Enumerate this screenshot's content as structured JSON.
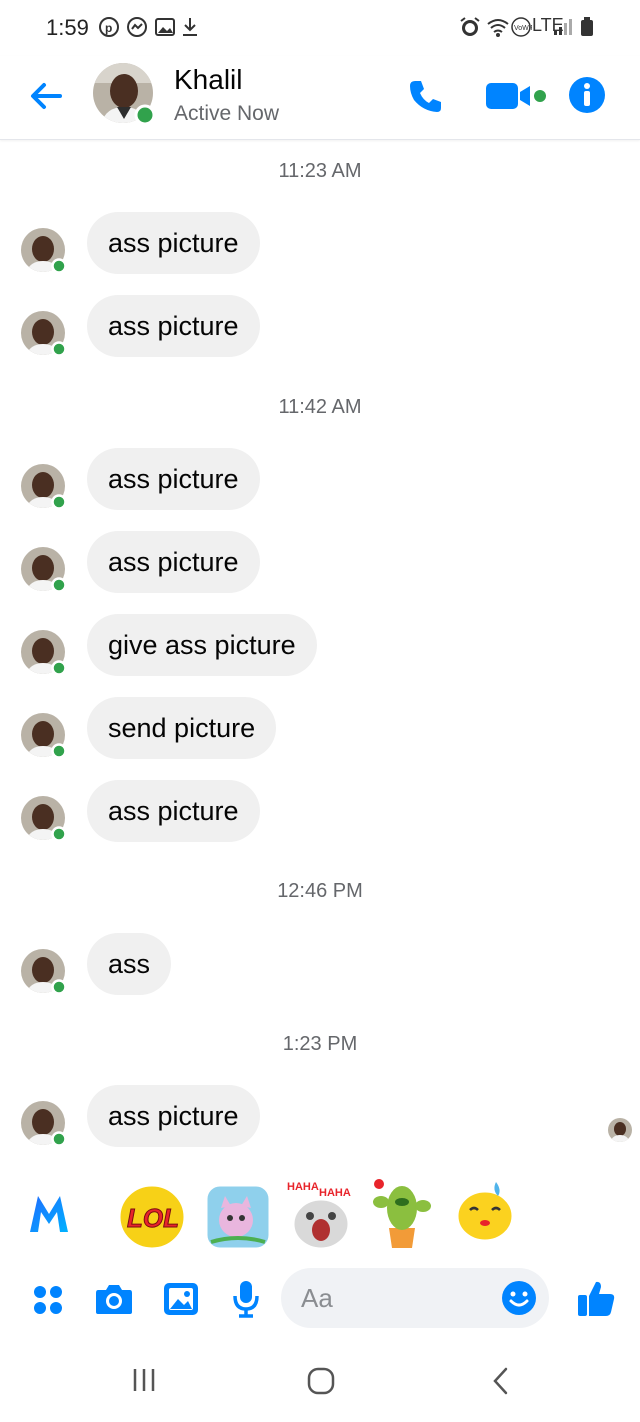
{
  "status_bar": {
    "time": "1:59",
    "network": "LTE"
  },
  "header": {
    "contact_name": "Khalil",
    "status": "Active Now"
  },
  "conversation": {
    "timestamps": [
      "11:23 AM",
      "11:42 AM",
      "12:46 PM",
      "1:23 PM"
    ],
    "messages": [
      "ass picture",
      "ass picture",
      "ass picture",
      "ass picture",
      "give ass picture",
      "send picture",
      "ass picture",
      "ass",
      "ass picture"
    ]
  },
  "stickers": {
    "lol_text": "LOL",
    "haha_text": "HAHA"
  },
  "composer": {
    "placeholder": "Aa"
  },
  "colors": {
    "accent": "#0084ff",
    "bubble": "#f0f0f0",
    "online": "#31a24c"
  }
}
